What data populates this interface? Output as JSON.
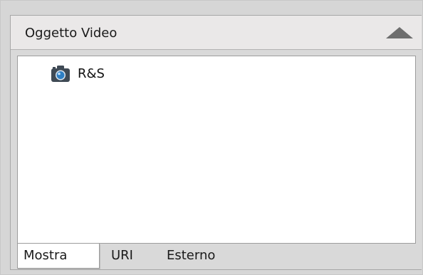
{
  "panel": {
    "title": "Oggetto Video",
    "collapse_icon": "triangle-up-icon"
  },
  "tree": {
    "items": [
      {
        "label": "R&S",
        "icon": "camera-icon",
        "icon_color": "#2e7fc4"
      }
    ]
  },
  "tabs": [
    {
      "label": "Mostra",
      "active": true
    },
    {
      "label": "URI",
      "active": false
    },
    {
      "label": "Esterno",
      "active": false
    }
  ],
  "colors": {
    "panel_bg": "#d9d9d9",
    "header_bg": "#eae8e8",
    "content_bg": "#ffffff",
    "icon_gray": "#6e6e6e"
  }
}
